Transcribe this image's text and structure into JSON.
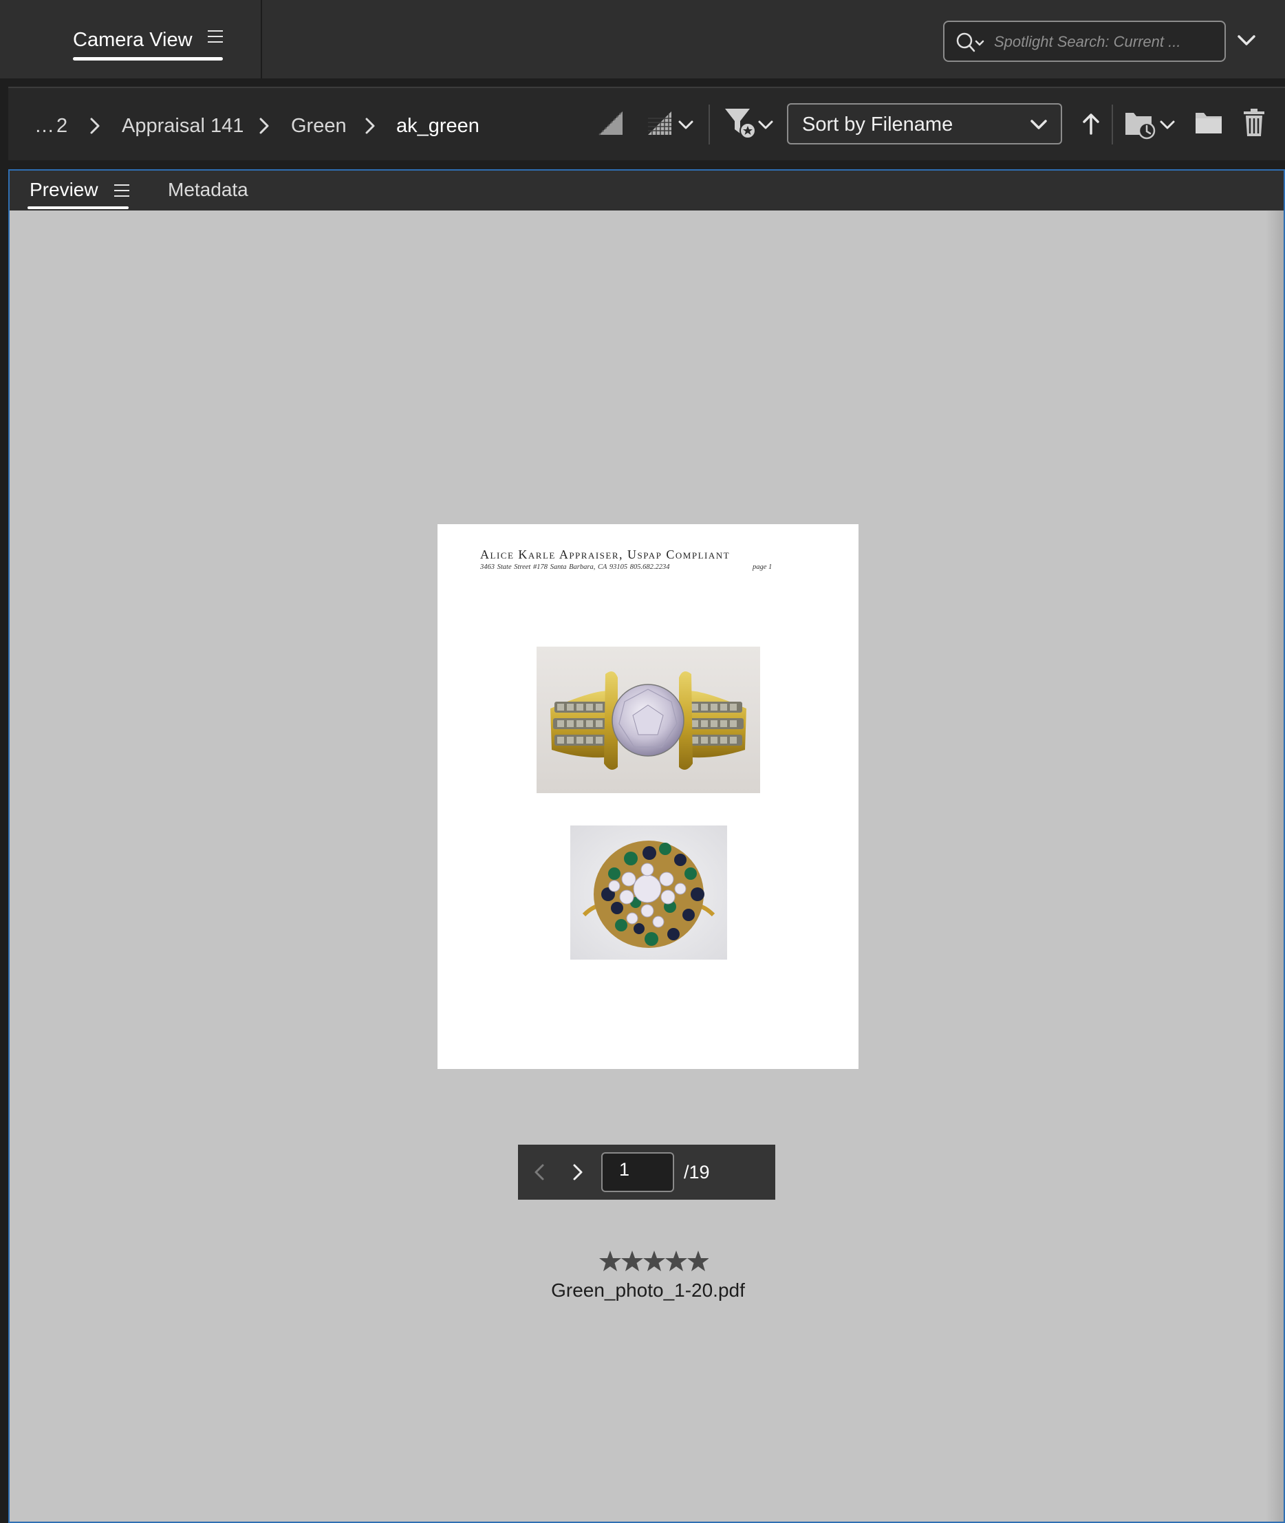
{
  "workspace": {
    "tab_label": "Camera View"
  },
  "search": {
    "placeholder": "Spotlight Search: Current ..."
  },
  "breadcrumb": {
    "items": [
      "…",
      "2",
      "Appraisal 141",
      "Green",
      "ak_green"
    ]
  },
  "toolbar": {
    "sort_label": "Sort by Filename"
  },
  "panel": {
    "tabs": [
      {
        "label": "Preview",
        "active": true
      },
      {
        "label": "Metadata",
        "active": false
      }
    ]
  },
  "document": {
    "title": "Alice Karle Appraiser, Uspap Compliant",
    "address_line": "3463 State Street #178   Santa Barbara, CA 93105   805.682.2234",
    "page_label": "page 1"
  },
  "preview": {
    "filename": "Green_photo_1-20.pdf",
    "rating": 5,
    "page_current": "1",
    "page_total": "/19"
  },
  "colors": {
    "accent_border": "#2f6fb3",
    "panel_bg": "#c4c4c4",
    "chrome_bg": "#2f2f2f"
  }
}
